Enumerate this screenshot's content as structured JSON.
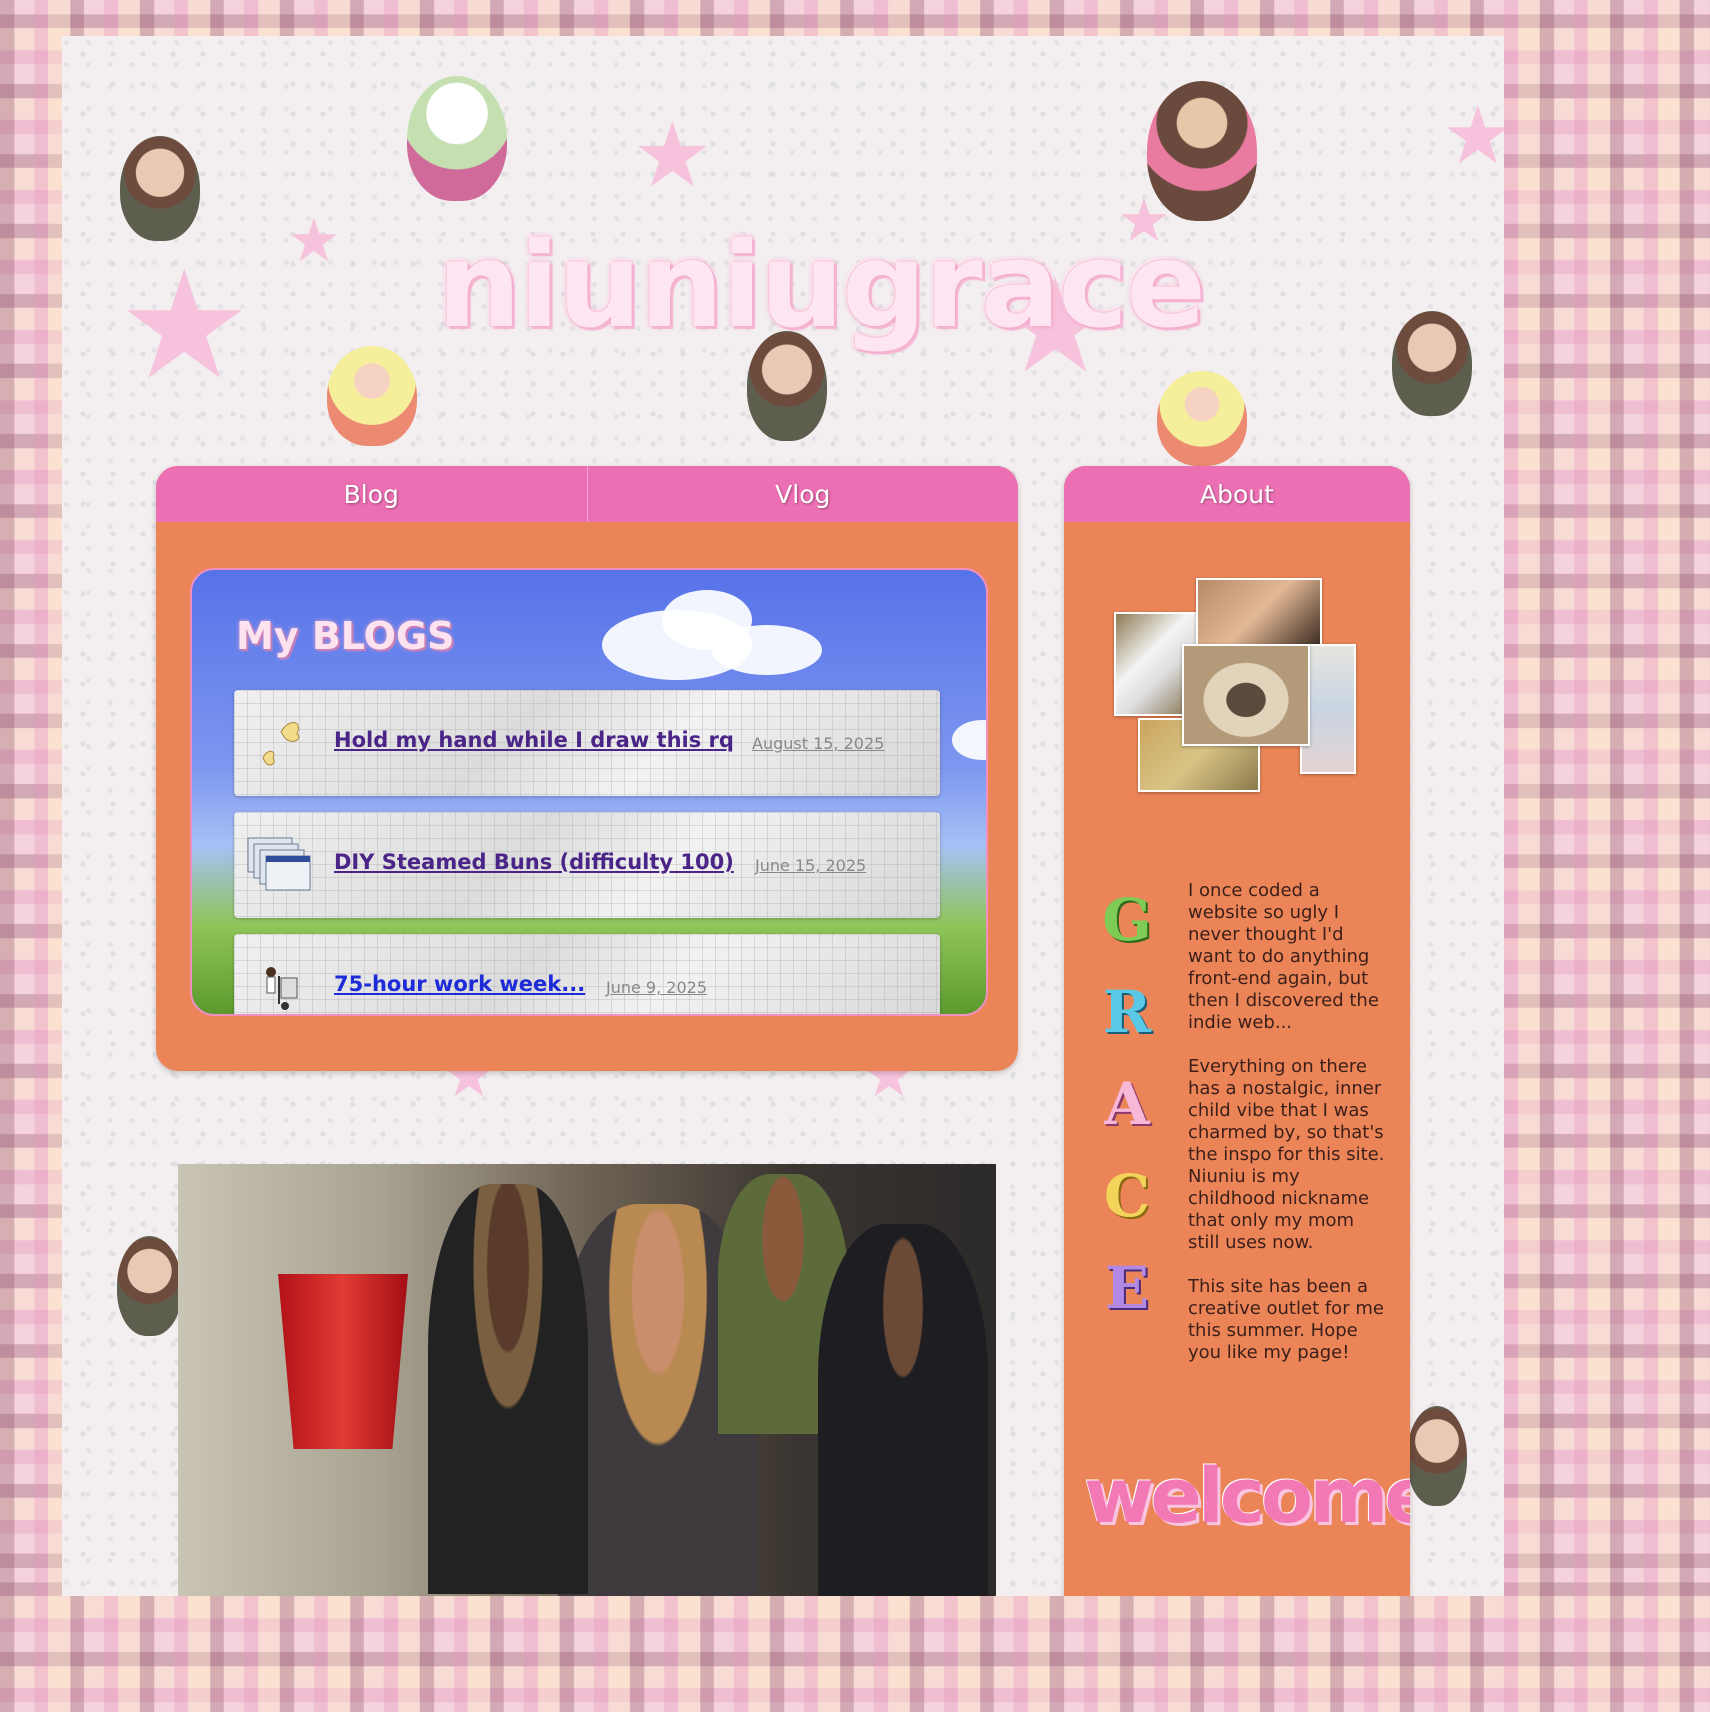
{
  "site": {
    "title": "niuniugrace"
  },
  "nav": {
    "tabs": [
      {
        "label": "Blog"
      },
      {
        "label": "Vlog"
      }
    ],
    "about_tab": "About"
  },
  "blogs": {
    "heading": "My BLOGS",
    "posts": [
      {
        "title": "Hold my hand while I draw this rq",
        "date": "August 15, 2025",
        "icon": "butterflies-icon"
      },
      {
        "title": "DIY Steamed Buns (difficulty 100)",
        "date": "June 15, 2025",
        "icon": "stacked-windows-icon"
      },
      {
        "title": "75-hour work week...",
        "date": "June 9, 2025",
        "icon": "dolly-worker-icon"
      }
    ]
  },
  "about": {
    "letters": [
      "G",
      "R",
      "A",
      "C",
      "E"
    ],
    "paragraphs": [
      "I once coded a website so ugly I never thought I'd want to do anything front-end again, but then I discovered the indie web...",
      "Everything on there has a nostalgic, inner child vibe that I was charmed by, so that's the inspo for this site. Niuniu is my childhood nickname that only my mom still uses now.",
      "This site has been a creative outlet for me this summer. Hope you like my page!"
    ],
    "welcome": "welcome"
  },
  "colors": {
    "tab_pink": "#ec6fb3",
    "card_orange": "#eb8457",
    "title_pink": "#fde6f1",
    "link_purple": "#4b2488"
  }
}
